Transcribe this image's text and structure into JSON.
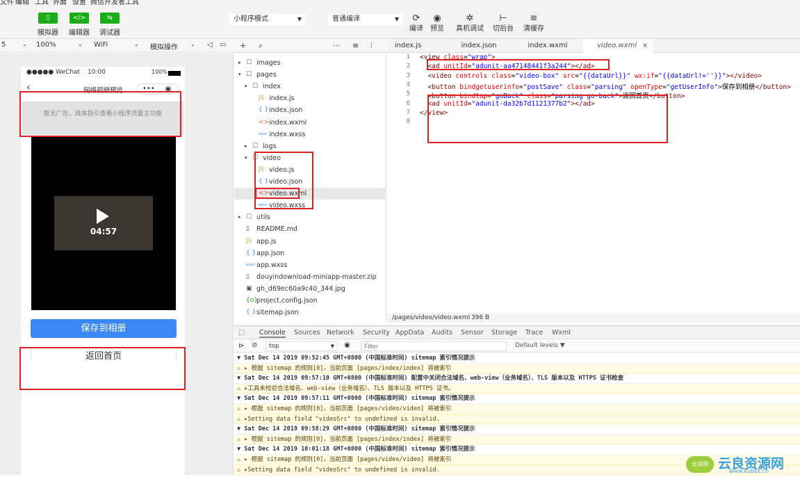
{
  "menubar": {
    "items": [
      "文件",
      "编辑",
      "工具",
      "界面",
      "设置",
      "微信开发者工具"
    ]
  },
  "toolbar": {
    "left_buttons": [
      {
        "icon": "phone-icon",
        "label": "模拟器"
      },
      {
        "icon": "code-icon",
        "label": "编辑器"
      },
      {
        "icon": "debug-icon",
        "label": "调试器"
      }
    ],
    "mode_select": "小程序模式",
    "compile_select": "普通编译",
    "right_buttons": [
      {
        "icon": "refresh-icon",
        "label": "编译"
      },
      {
        "icon": "eye-icon",
        "label": "预览"
      },
      {
        "icon": "bug-icon",
        "label": "真机调试"
      },
      {
        "icon": "switch-icon",
        "label": "切后台"
      },
      {
        "icon": "layers-icon",
        "label": "清缓存"
      }
    ]
  },
  "simbar": {
    "scale": "5",
    "zoom": "100%",
    "network": "WiFi",
    "operation": "模拟操作"
  },
  "simulator": {
    "carrier": "●●●●● WeChat",
    "time": "10:00",
    "battery": "100%",
    "nav_title": "网络视频预览",
    "ad_text": "暂无广告，具体指引查看小程序流量主功能",
    "duration": "04:57",
    "save_button": "保存到相册",
    "back_button": "返回首页"
  },
  "filetree": {
    "toolbar": {
      "add": "+",
      "search": "⌕",
      "more": "···",
      "sort": "≡",
      "split": "⫶"
    },
    "rows": [
      {
        "arrow": "▸",
        "icon": "☐",
        "icon_color": "#555",
        "name": "images",
        "indent": 0
      },
      {
        "arrow": "▾",
        "icon": "☐",
        "icon_color": "#555",
        "name": "pages",
        "indent": 0
      },
      {
        "arrow": "▾",
        "icon": "☐",
        "icon_color": "#555",
        "name": "index",
        "indent": 1
      },
      {
        "arrow": "",
        "icon": "JS",
        "icon_color": "#e6a23c",
        "name": "index.js",
        "indent": 2
      },
      {
        "arrow": "",
        "icon": "{ }",
        "icon_color": "#3a88f5",
        "name": "index.json",
        "indent": 2
      },
      {
        "arrow": "",
        "icon": "<>",
        "icon_color": "#e6543c",
        "name": "index.wxml",
        "indent": 2
      },
      {
        "arrow": "",
        "icon": "wxss",
        "icon_color": "#3a88f5",
        "name": "index.wxss",
        "indent": 2
      },
      {
        "arrow": "▸",
        "icon": "☐",
        "icon_color": "#555",
        "name": "logs",
        "indent": 1
      },
      {
        "arrow": "▾",
        "icon": "☐",
        "icon_color": "#555",
        "name": "video",
        "indent": 1
      },
      {
        "arrow": "",
        "icon": "JS",
        "icon_color": "#e6a23c",
        "name": "video.js",
        "indent": 2
      },
      {
        "arrow": "",
        "icon": "{ }",
        "icon_color": "#3a88f5",
        "name": "video.json",
        "indent": 2
      },
      {
        "arrow": "",
        "icon": "<>",
        "icon_color": "#e6543c",
        "name": "video.wxml",
        "indent": 2,
        "selected": true
      },
      {
        "arrow": "",
        "icon": "wxss",
        "icon_color": "#3a88f5",
        "name": "video.wxss",
        "indent": 2
      },
      {
        "arrow": "▸",
        "icon": "☐",
        "icon_color": "#555",
        "name": "utils",
        "indent": 0
      },
      {
        "arrow": "",
        "icon": "▯",
        "icon_color": "#555",
        "name": "README.md",
        "indent": 0
      },
      {
        "arrow": "",
        "icon": "JS",
        "icon_color": "#e6a23c",
        "name": "app.js",
        "indent": 0
      },
      {
        "arrow": "",
        "icon": "{ }",
        "icon_color": "#3a88f5",
        "name": "app.json",
        "indent": 0
      },
      {
        "arrow": "",
        "icon": "wxss",
        "icon_color": "#3a88f5",
        "name": "app.wxss",
        "indent": 0
      },
      {
        "arrow": "",
        "icon": "▯",
        "icon_color": "#555",
        "name": "douyindownload-miniapp-master.zip",
        "indent": 0
      },
      {
        "arrow": "",
        "icon": "▣",
        "icon_color": "#555",
        "name": "gh_d69ec60a9c40_344.jpg",
        "indent": 0
      },
      {
        "arrow": "",
        "icon": "{o}",
        "icon_color": "#1aad19",
        "name": "project.config.json",
        "indent": 0
      },
      {
        "arrow": "",
        "icon": "{ }",
        "icon_color": "#3a88f5",
        "name": "sitemap.json",
        "indent": 0
      }
    ]
  },
  "editor": {
    "tabs": [
      "index.js",
      "index.json",
      "index.wxml",
      "video.wxml"
    ],
    "active_tab": "video.wxml",
    "close": "×",
    "lines": [
      [
        [
          "t",
          "<view "
        ],
        [
          "a",
          "class"
        ],
        [
          "x",
          "="
        ],
        [
          "v",
          "\"wrap\""
        ],
        [
          "t",
          ">"
        ]
      ],
      [
        [
          "x",
          "  "
        ],
        [
          "t",
          "<ad "
        ],
        [
          "a",
          "unitId"
        ],
        [
          "x",
          "="
        ],
        [
          "v",
          "\"adunit-aa47148441f3a244\""
        ],
        [
          "t",
          "></ad>"
        ]
      ],
      [
        [
          "x",
          "  "
        ],
        [
          "t",
          "<video "
        ],
        [
          "a",
          "controls class"
        ],
        [
          "x",
          "="
        ],
        [
          "v",
          "\"video-box\" "
        ],
        [
          "a",
          "src"
        ],
        [
          "x",
          "="
        ],
        [
          "v",
          "\"{{dataUrl}}\" "
        ],
        [
          "a",
          "wx:if"
        ],
        [
          "x",
          "="
        ],
        [
          "v",
          "\"{{dataUrl!=''}}\""
        ],
        [
          "t",
          "></video>"
        ]
      ],
      [
        [
          "x",
          "  "
        ],
        [
          "t",
          "<button "
        ],
        [
          "a",
          "bindgetuserinfo"
        ],
        [
          "x",
          "="
        ],
        [
          "v",
          "\"postSave\" "
        ],
        [
          "a",
          "class"
        ],
        [
          "x",
          "="
        ],
        [
          "v",
          "\"parsing\" "
        ],
        [
          "a",
          "openType"
        ],
        [
          "x",
          "="
        ],
        [
          "v",
          "\"getUserInfo\""
        ],
        [
          "t",
          ">"
        ],
        [
          "x",
          "保存到相册"
        ],
        [
          "t",
          "</button>"
        ]
      ],
      [
        [
          "x",
          "  "
        ],
        [
          "t",
          "<button "
        ],
        [
          "a",
          "bindtap"
        ],
        [
          "x",
          "="
        ],
        [
          "v",
          "\"goBack\" "
        ],
        [
          "a",
          "class"
        ],
        [
          "x",
          "="
        ],
        [
          "v",
          "\"parsing go-back\""
        ],
        [
          "t",
          ">"
        ],
        [
          "x",
          "返回首页"
        ],
        [
          "t",
          "</button>"
        ]
      ],
      [
        [
          "x",
          "  "
        ],
        [
          "t",
          "<ad "
        ],
        [
          "a",
          "unitId"
        ],
        [
          "x",
          "="
        ],
        [
          "v",
          "\"adunit-da32b7d1121377b2\""
        ],
        [
          "t",
          "></ad>"
        ]
      ],
      [
        [
          "t",
          "</view>"
        ]
      ],
      [
        [
          "x",
          ""
        ]
      ]
    ],
    "line_numbers": [
      "1",
      "2",
      "3",
      "4",
      "5",
      "6",
      "7",
      "8"
    ],
    "status_path": "/pages/video/video.wxml",
    "status_size": "396 B"
  },
  "console": {
    "tabs": [
      "Console",
      "Sources",
      "Network",
      "Security",
      "AppData",
      "Audits",
      "Sensor",
      "Storage",
      "Trace",
      "Wxml"
    ],
    "active_tab": "Console",
    "context": "top",
    "filter_placeholder": "Filter",
    "levels": "Default levels ▼",
    "rows": [
      {
        "type": "info",
        "text": "▼ Sat Dec 14 2019 09:52:45 GMT+0800 (中国标准时间) sitemap 索引情况提示"
      },
      {
        "type": "warn",
        "text": "  ⚠ ▸ 根据 sitemap 的规则[0]，当前页面 [pages/index/index] 将被索引"
      },
      {
        "type": "info",
        "text": "▼ Sat Dec 14 2019 09:57:10 GMT+0800 (中国标准时间) 配置中关闭合法域名、web-view（业务域名）、TLS 版本以及 HTTPS 证书检查"
      },
      {
        "type": "warn",
        "text": "  ⚠ ▸工具未校验合法域名、web-view（业务域名）、TLS 版本以及 HTTPS 证书。"
      },
      {
        "type": "info",
        "text": "▼ Sat Dec 14 2019 09:57:11 GMT+0800 (中国标准时间) sitemap 索引情况提示"
      },
      {
        "type": "warn",
        "text": "  ⚠ ▸ 根据 sitemap 的规则[0]，当前页面 [pages/video/video] 将被索引"
      },
      {
        "type": "warn",
        "text": "⚠ ▸Setting data field \"videoSrc\" to undefined is invalid."
      },
      {
        "type": "info",
        "text": "▼ Sat Dec 14 2019 09:58:29 GMT+0800 (中国标准时间) sitemap 索引情况提示"
      },
      {
        "type": "warn",
        "text": "  ⚠ ▸ 根据 sitemap 的规则[0]，当前页面 [pages/index/index] 将被索引"
      },
      {
        "type": "info",
        "text": "▼ Sat Dec 14 2019 10:01:18 GMT+0800 (中国标准时间) sitemap 索引情况提示"
      },
      {
        "type": "warn",
        "text": "  ⚠ ▸ 根据 sitemap 的规则[0]，当前页面 [pages/video/video] 将被索引"
      },
      {
        "type": "warn",
        "text": "⚠ ▸Setting data field \"videoSrc\" to undefined is invalid."
      }
    ]
  },
  "watermark": {
    "text": "云良资源网",
    "url": "www.kubbs.cn",
    "badge": "云良网"
  },
  "colors": {
    "green": "#1aad19",
    "blue": "#3a88f5",
    "red_highlight": "#e02020"
  }
}
